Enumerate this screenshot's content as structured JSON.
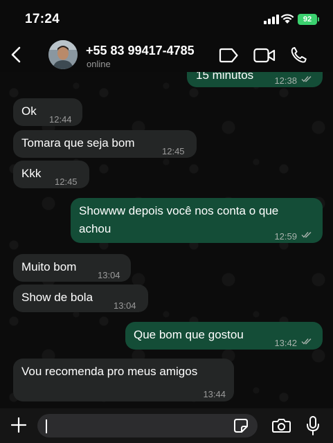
{
  "status_bar": {
    "time": "17:24",
    "battery": "92"
  },
  "header": {
    "contact_name": "+55 83 99417-4785",
    "contact_status": "online",
    "icons": [
      "back-icon",
      "avatar",
      "labels-icon",
      "video-call-icon",
      "voice-call-icon"
    ]
  },
  "messages": [
    {
      "dir": "out",
      "text": "15 minutos",
      "time": "12:38",
      "read": true
    },
    {
      "dir": "in",
      "text": "Ok",
      "time": "12:44"
    },
    {
      "dir": "in",
      "text": "Tomara que seja bom",
      "time": "12:45"
    },
    {
      "dir": "in",
      "text": "Kkk",
      "time": "12:45"
    },
    {
      "dir": "out",
      "text_line1": "Showww depois você nos conta o que",
      "text_line2": "achou",
      "time": "12:59",
      "read": true
    },
    {
      "dir": "in",
      "text": "Muito bom",
      "time": "13:04"
    },
    {
      "dir": "in",
      "text": "Show de bola",
      "time": "13:04"
    },
    {
      "dir": "out",
      "text": "Que bom que gostou",
      "time": "13:42",
      "read": true
    },
    {
      "dir": "in",
      "text": "Vou recomenda pro meus amigos",
      "time": "13:44"
    }
  ],
  "input_bar": {
    "placeholder": "",
    "icons": [
      "plus-icon",
      "sticker-icon",
      "camera-icon",
      "mic-icon"
    ]
  },
  "colors": {
    "incoming": "#242626",
    "outgoing": "#144d37",
    "background": "#0b0b0b",
    "battery": "#3bd16f"
  }
}
